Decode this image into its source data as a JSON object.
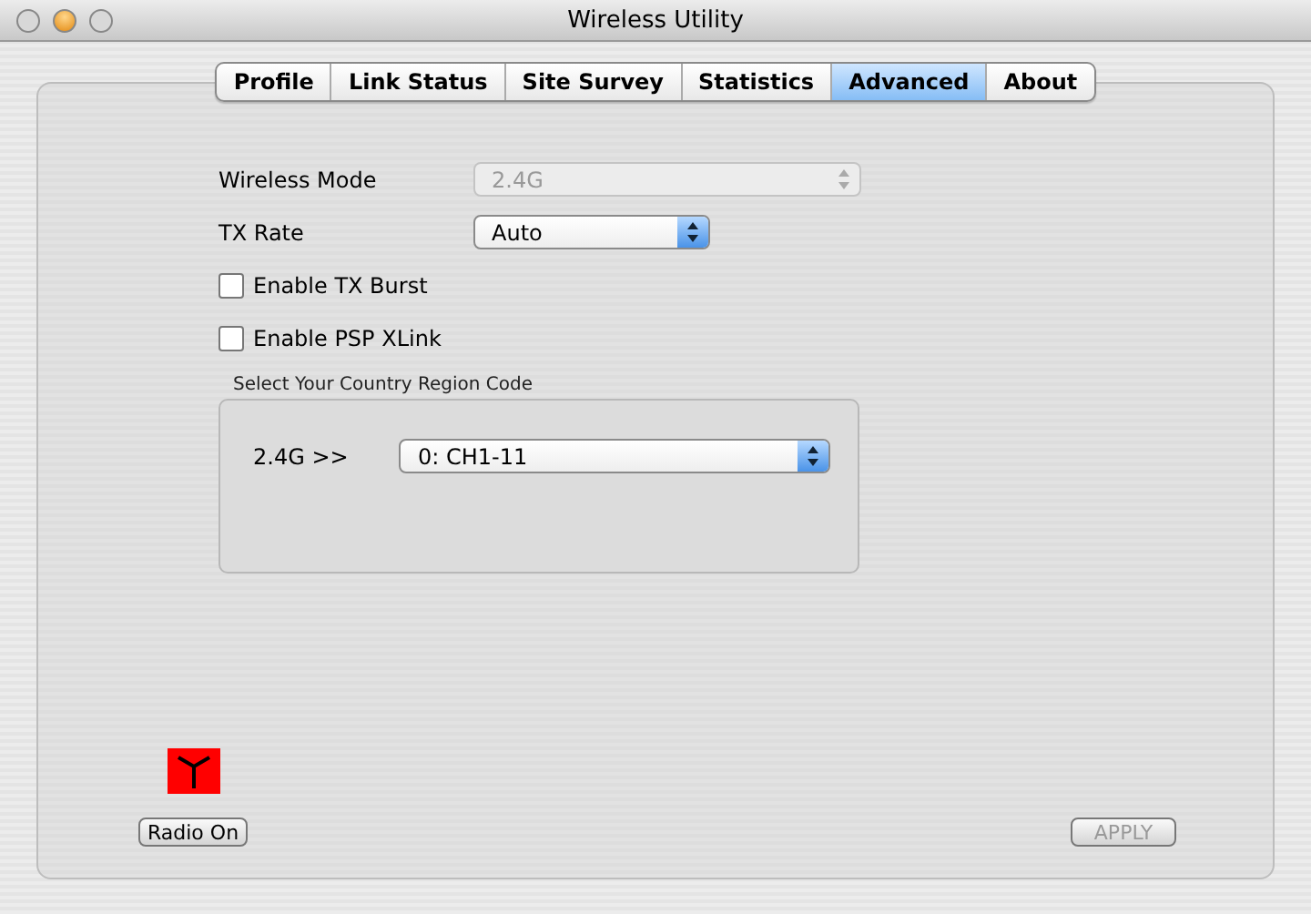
{
  "window": {
    "title": "Wireless Utility"
  },
  "tabs": [
    {
      "label": "Profile",
      "selected": false
    },
    {
      "label": "Link Status",
      "selected": false
    },
    {
      "label": "Site Survey",
      "selected": false
    },
    {
      "label": "Statistics",
      "selected": false
    },
    {
      "label": "Advanced",
      "selected": true
    },
    {
      "label": "About",
      "selected": false
    }
  ],
  "settings": [
    {
      "kind": "select",
      "label": "Wireless Mode",
      "value": "2.4G",
      "disabled": true
    },
    {
      "kind": "select",
      "label": "TX Rate",
      "value": "Auto",
      "disabled": false
    },
    {
      "kind": "checkbox",
      "label": "Enable TX Burst",
      "checked": false
    },
    {
      "kind": "checkbox",
      "label": "Enable PSP XLink",
      "checked": false
    }
  ],
  "region": {
    "title": "Select Your Country Region Code",
    "label": "2.4G >>",
    "value": "0: CH1-11"
  },
  "radio_button": {
    "label": "Radio On"
  },
  "apply_button": {
    "label": "APPLY",
    "disabled": true
  }
}
